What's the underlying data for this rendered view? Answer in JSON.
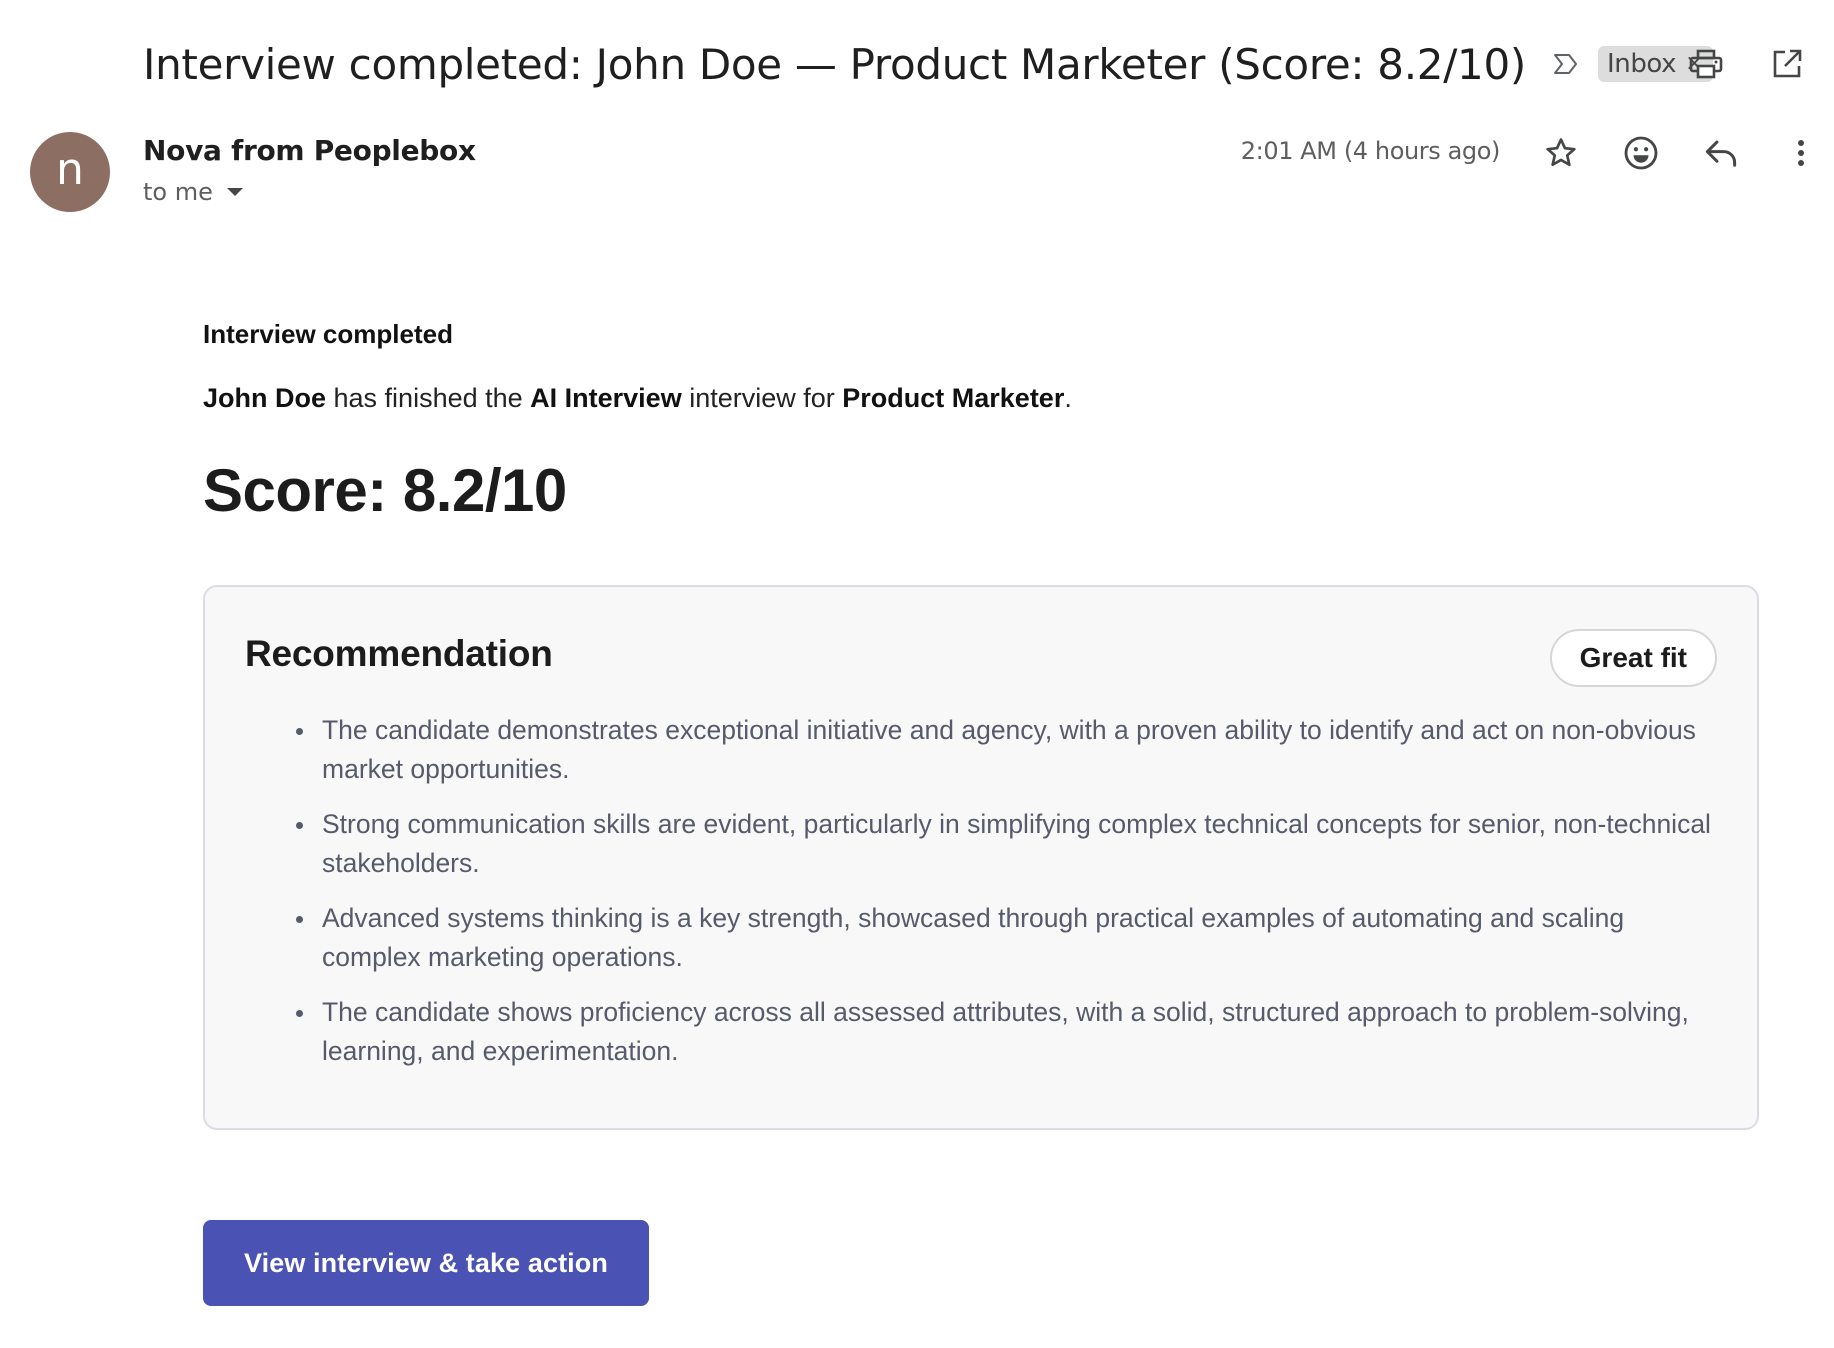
{
  "subject": {
    "title": "Interview completed: John Doe — Product Marketer (Score: 8.2/10)",
    "label": "Inbox"
  },
  "icons": {
    "important": "important-marker-icon",
    "label_close": "×",
    "print": "print-icon",
    "open_new_window": "open-in-new-window-icon",
    "star": "star-icon",
    "emoji": "emoji-reaction-icon",
    "reply": "reply-icon",
    "more": "more-options-icon"
  },
  "sender": {
    "avatar_letter": "n",
    "avatar_color": "#8d6e63",
    "name": "Nova from Peoplebox",
    "recipient": "to me",
    "time": "2:01 AM (4 hours ago)"
  },
  "body": {
    "heading": "Interview completed",
    "intro": {
      "candidate": "John Doe",
      "text1": " has finished the ",
      "interview_type": "AI Interview",
      "text2": " interview for ",
      "role": "Product Marketer",
      "text3": "."
    },
    "score": "Score: 8.2/10",
    "recommendation": {
      "title": "Recommendation",
      "badge": "Great fit",
      "items": [
        "The candidate demonstrates exceptional initiative and agency, with a proven ability to identify and act on non-obvious market opportunities.",
        "Strong communication skills are evident, particularly in simplifying complex technical concepts for senior, non-technical stakeholders.",
        "Advanced systems thinking is a key strength, showcased through practical examples of automating and scaling complex marketing operations.",
        "The candidate shows proficiency across all assessed attributes, with a solid, structured approach to problem-solving, learning, and experimentation."
      ]
    },
    "cta_label": "View interview & take action",
    "cta_color": "#4a52b3"
  }
}
